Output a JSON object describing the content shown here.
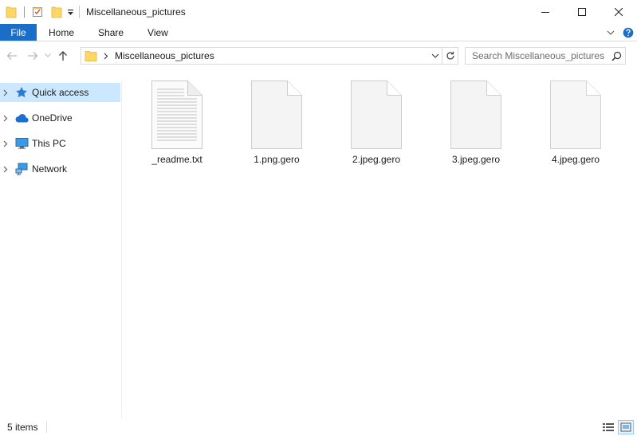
{
  "window": {
    "title": "Miscellaneous_pictures"
  },
  "ribbon": {
    "tabs": [
      {
        "label": "File"
      },
      {
        "label": "Home"
      },
      {
        "label": "Share"
      },
      {
        "label": "View"
      }
    ]
  },
  "address": {
    "path": "Miscellaneous_pictures"
  },
  "search": {
    "placeholder": "Search Miscellaneous_pictures"
  },
  "nav": {
    "items": [
      {
        "label": "Quick access",
        "icon": "star-icon",
        "selected": true
      },
      {
        "label": "OneDrive",
        "icon": "cloud-icon",
        "selected": false
      },
      {
        "label": "This PC",
        "icon": "computer-icon",
        "selected": false
      },
      {
        "label": "Network",
        "icon": "network-icon",
        "selected": false
      }
    ]
  },
  "files": [
    {
      "name": "_readme.txt",
      "icon": "text-document-icon"
    },
    {
      "name": "1.png.gero",
      "icon": "blank-file-icon"
    },
    {
      "name": "2.jpeg.gero",
      "icon": "blank-file-icon"
    },
    {
      "name": "3.jpeg.gero",
      "icon": "blank-file-icon"
    },
    {
      "name": "4.jpeg.gero",
      "icon": "blank-file-icon"
    }
  ],
  "status": {
    "item_count": "5 items"
  },
  "colors": {
    "file_tab": "#1a6ec8",
    "selection": "#cce8ff",
    "folder": "#ffd766"
  }
}
